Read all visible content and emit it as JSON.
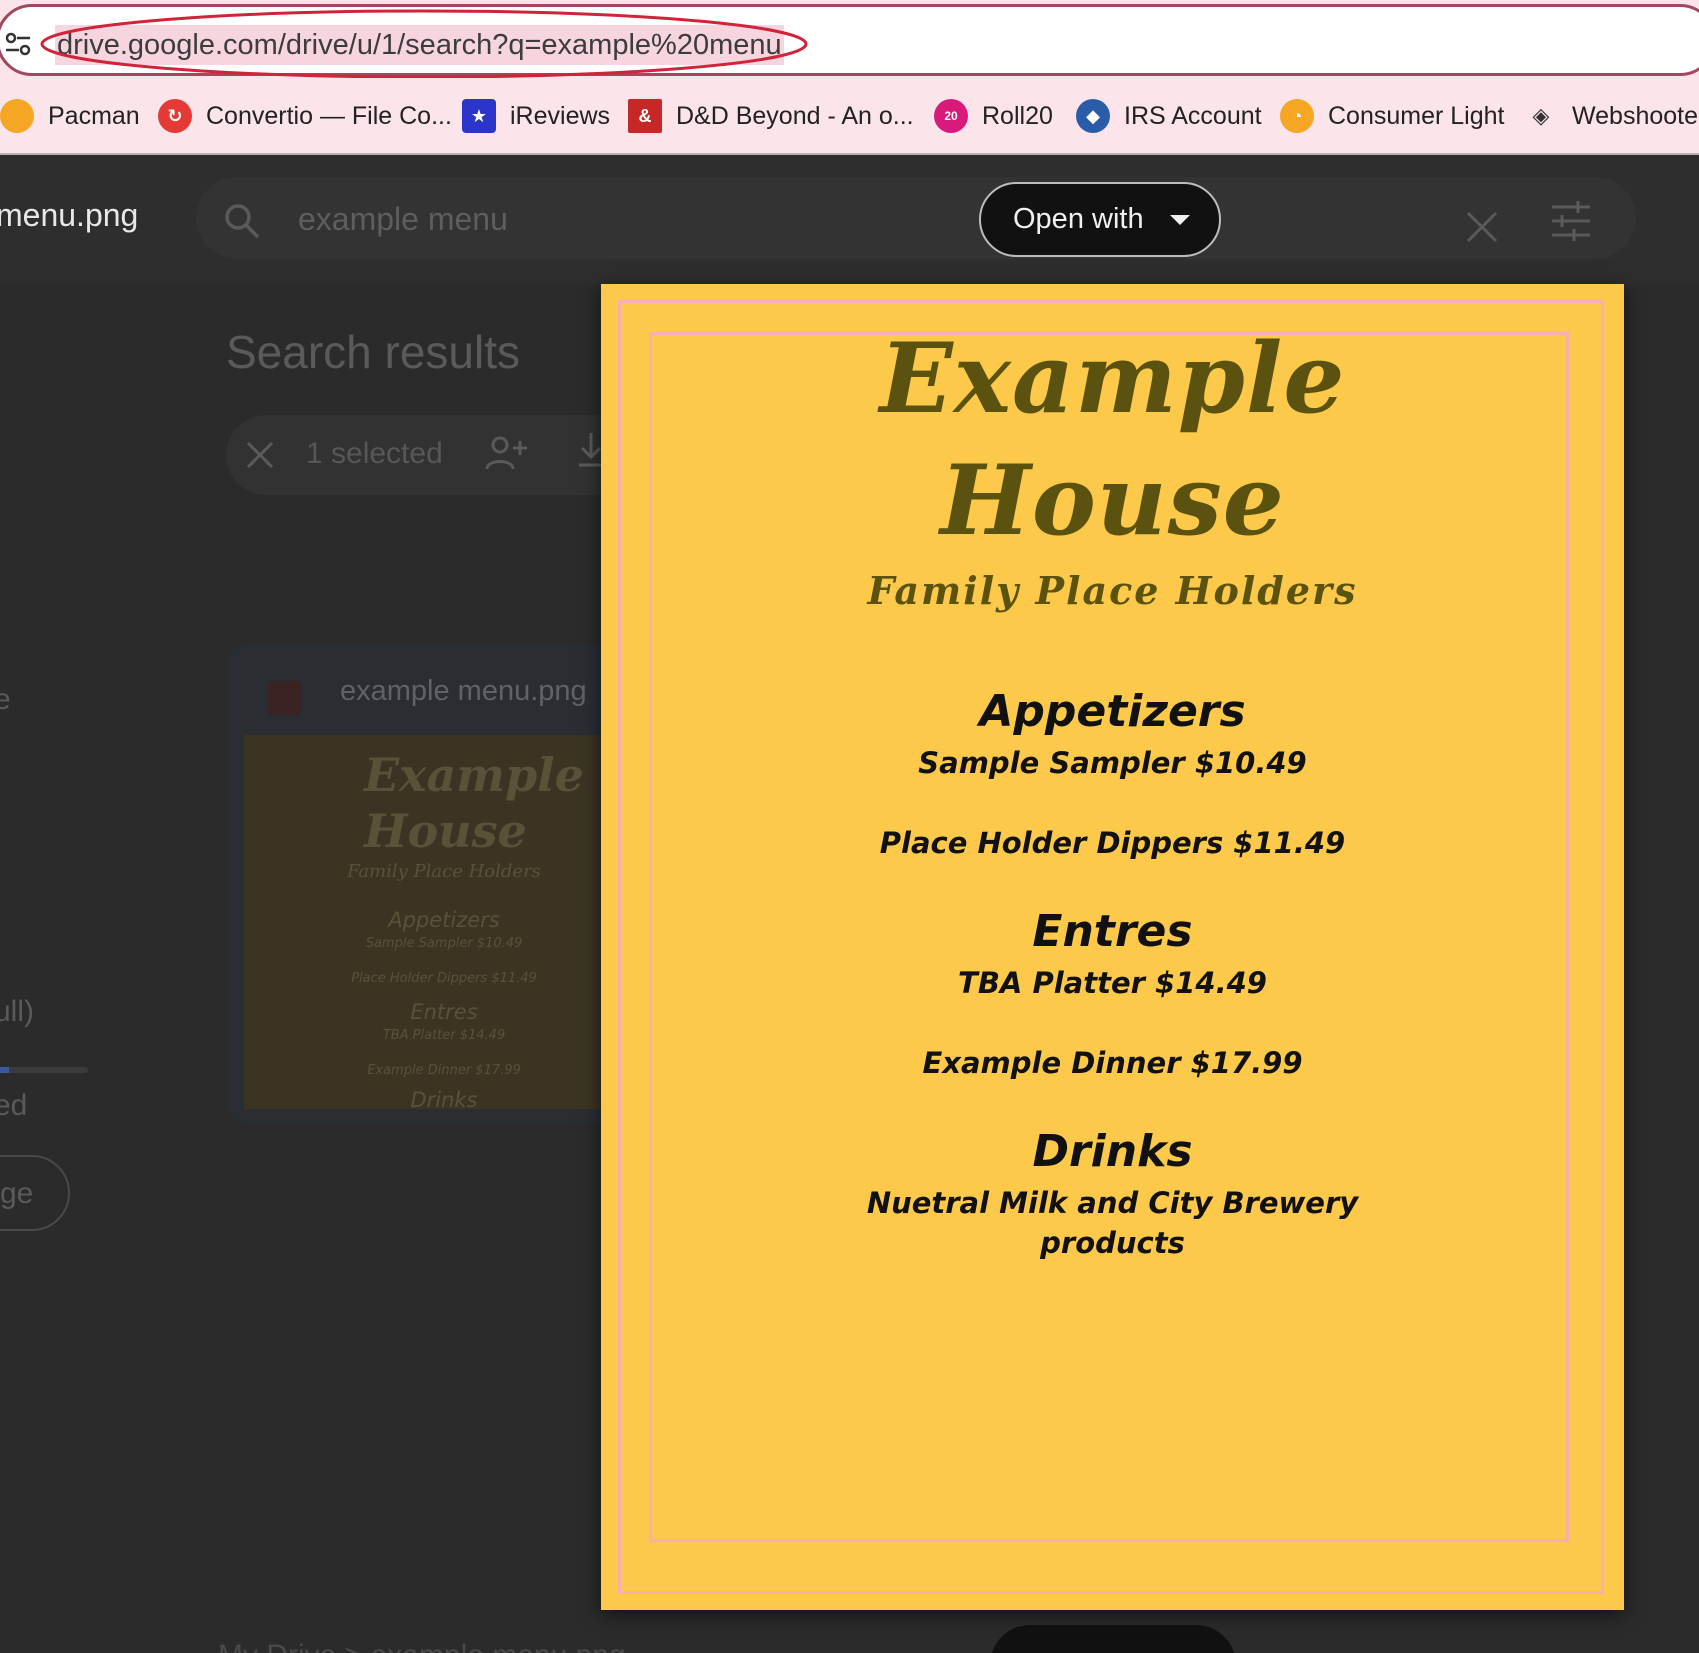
{
  "browser": {
    "url": "drive.google.com/drive/u/1/search?q=example%20menu",
    "bookmarks": [
      {
        "label": "Pacman",
        "icon": "pacman-icon",
        "color": "#f5a623"
      },
      {
        "label": "Convertio — File Co...",
        "icon": "convertio-icon",
        "color": "#e53935"
      },
      {
        "label": "iReviews",
        "icon": "star-badge-icon",
        "color": "#2b35c9"
      },
      {
        "label": "D&D Beyond - An o...",
        "icon": "dnd-beyond-icon",
        "color": "#c62828"
      },
      {
        "label": "Roll20",
        "icon": "d20-icon",
        "color": "#d81b7a"
      },
      {
        "label": "IRS Account",
        "icon": "irs-eagle-icon",
        "color": "#2a5caa"
      },
      {
        "label": "Consumer Light",
        "icon": "consumer-light-icon",
        "color": "#f5a623"
      },
      {
        "label": "Webshooter",
        "icon": "webshooter-icon",
        "color": "#333333"
      }
    ]
  },
  "drive": {
    "file_title": "menu.png",
    "search_query": "example menu",
    "open_with_label": "Open with",
    "search_results_heading": "Search results",
    "selected_count": "1 selected",
    "sidebar_fragments": [
      "e",
      "ull)",
      "ed",
      "ge"
    ],
    "storage_fraction": 0.12,
    "file_card_name": "example menu.png",
    "breadcrumb": "My Drive   >   example menu.png",
    "thumbnail": {
      "title": "Example House",
      "tagline": "Family Place Holders",
      "sections": [
        {
          "heading": "Appetizers",
          "items": [
            "Sample Sampler $10.49",
            "Place Holder Dippers $11.49"
          ]
        },
        {
          "heading": "Entres",
          "items": [
            "TBA Platter $14.49",
            "Example Dinner $17.99"
          ]
        },
        {
          "heading": "Drinks",
          "items": []
        }
      ]
    }
  },
  "menu": {
    "title_line1": "Example",
    "title_line2": "House",
    "tagline": "Family Place Holders",
    "sections": [
      {
        "heading": "Appetizers",
        "items": [
          "Sample Sampler $10.49",
          "Place Holder Dippers $11.49"
        ]
      },
      {
        "heading": "Entres",
        "items": [
          "TBA Platter $14.49",
          "Example Dinner $17.99"
        ]
      },
      {
        "heading": "Drinks",
        "items": [
          "Nuetral Milk and City Brewery",
          "products"
        ]
      }
    ]
  },
  "colors": {
    "menu_background": "#fcc94a",
    "menu_border": "#f4b0b2",
    "menu_title": "#5a520e",
    "annotation": "#d0243a"
  }
}
